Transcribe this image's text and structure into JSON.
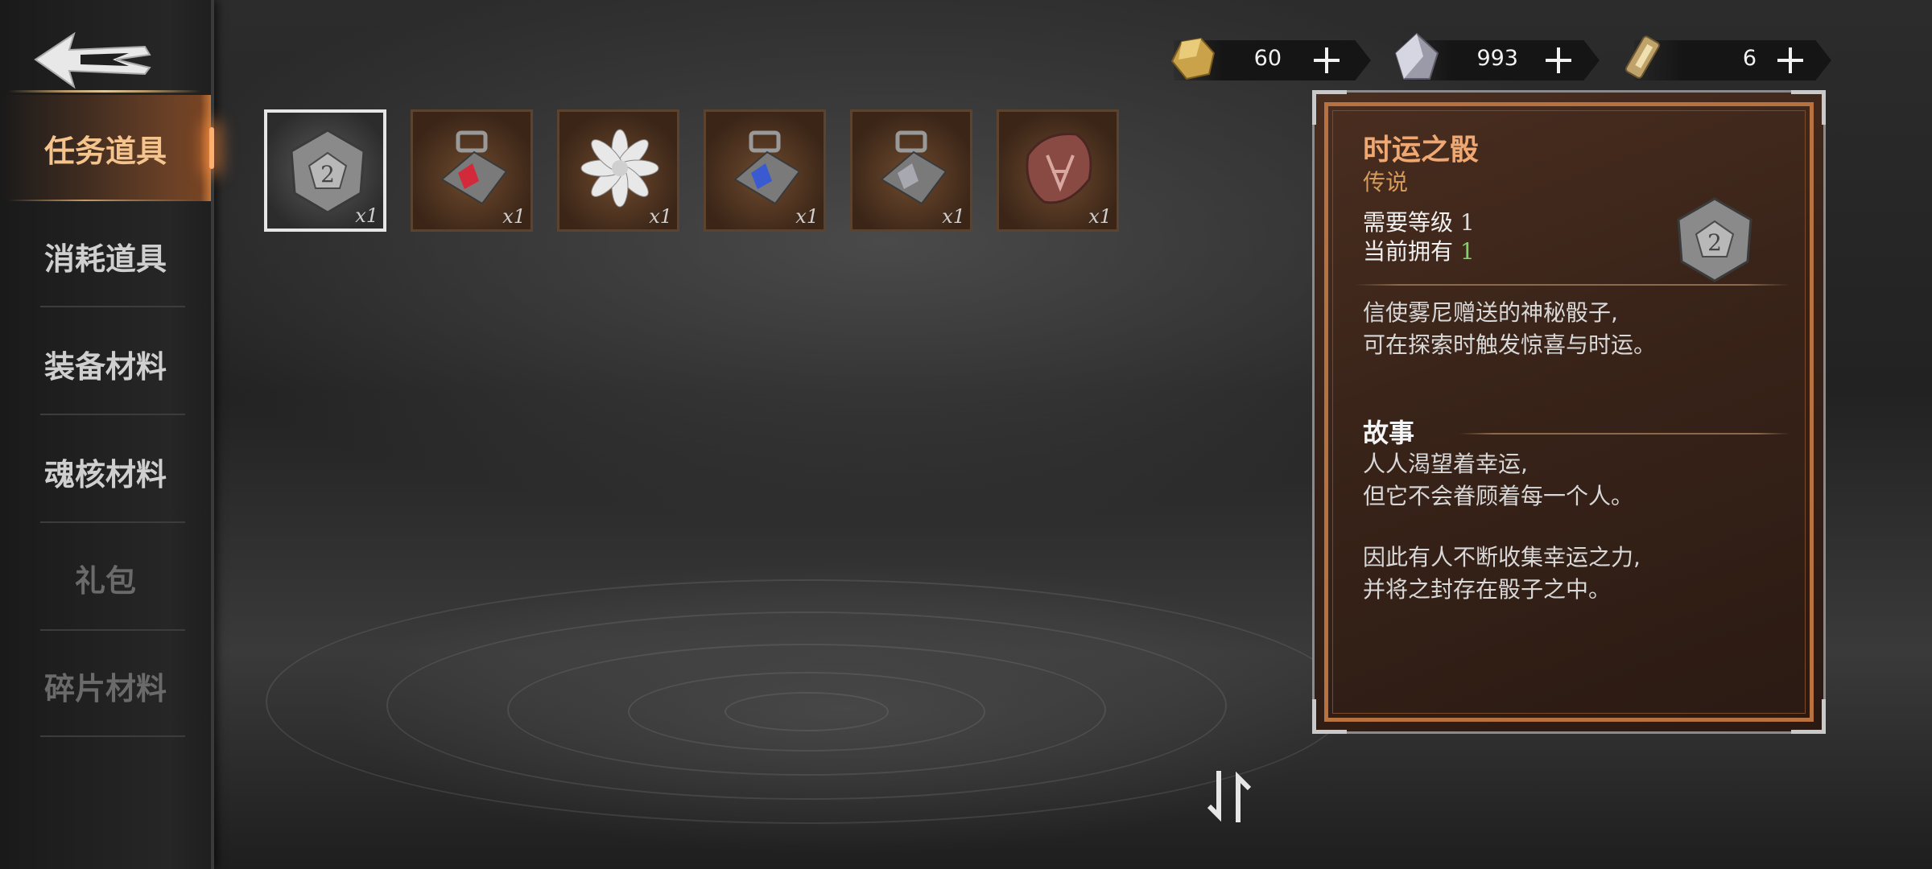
{
  "sidebar": {
    "back_icon": "back-arrow-icon",
    "items": [
      {
        "label": "任务道具",
        "state": "active"
      },
      {
        "label": "消耗道具",
        "state": "normal"
      },
      {
        "label": "装备材料",
        "state": "normal"
      },
      {
        "label": "魂核材料",
        "state": "normal"
      },
      {
        "label": "礼包",
        "state": "disabled"
      },
      {
        "label": "碎片材料",
        "state": "disabled"
      }
    ]
  },
  "currencies": [
    {
      "icon": "gold-ore-icon",
      "value": "60"
    },
    {
      "icon": "crystal-icon",
      "value": "993"
    },
    {
      "icon": "ticket-icon",
      "value": "6"
    }
  ],
  "inventory": {
    "items": [
      {
        "icon": "d12-dice-icon",
        "qty": "x1",
        "selected": true
      },
      {
        "icon": "red-gem-amulet-icon",
        "qty": "x1"
      },
      {
        "icon": "white-flower-icon",
        "qty": "x1"
      },
      {
        "icon": "blue-gem-amulet-icon",
        "qty": "x1"
      },
      {
        "icon": "grey-gem-amulet-icon",
        "qty": "x1"
      },
      {
        "icon": "rune-stone-icon",
        "qty": "x1"
      }
    ]
  },
  "detail": {
    "name": "时运之骰",
    "rarity": "传说",
    "level_label": "需要等级",
    "level_value": "1",
    "owned_label": "当前拥有",
    "owned_value": "1",
    "description": [
      "信使雾尼赠送的神秘骰子,",
      "可在探索时触发惊喜与时运。"
    ],
    "story_title": "故事",
    "story": [
      "人人渴望着幸运,",
      "但它不会眷顾着每一个人。",
      "",
      "因此有人不断收集幸运之力,",
      "并将之封存在骰子之中。"
    ]
  },
  "colors": {
    "accent_orange": "#f0a872",
    "rarity": "#d49a5a",
    "owned_green": "#7ed46a",
    "panel_border": "#b87240"
  },
  "sort_button_icon": "sort-arrows-icon"
}
